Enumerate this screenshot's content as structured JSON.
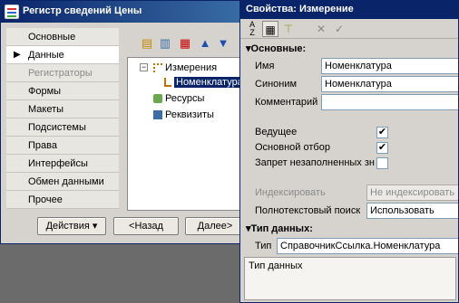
{
  "register_window": {
    "title": "Регистр сведений Цены",
    "nav": [
      {
        "label": "Основные",
        "state": "normal"
      },
      {
        "label": "Данные",
        "state": "active"
      },
      {
        "label": "Регистраторы",
        "state": "disabled"
      },
      {
        "label": "Формы",
        "state": "normal"
      },
      {
        "label": "Макеты",
        "state": "normal"
      },
      {
        "label": "Подсистемы",
        "state": "normal"
      },
      {
        "label": "Права",
        "state": "normal"
      },
      {
        "label": "Интерфейсы",
        "state": "normal"
      },
      {
        "label": "Обмен данными",
        "state": "normal"
      },
      {
        "label": "Прочее",
        "state": "normal"
      }
    ],
    "tree": {
      "dimensions": "Измерения",
      "selected": "Номенклатура",
      "resources": "Ресурсы",
      "attributes": "Реквизиты",
      "expand_symbol": "−"
    },
    "buttons": {
      "actions": "Действия",
      "back": "<Назад",
      "next": "Далее>"
    },
    "active_marker": "▶",
    "dropdown_arrow": "▾"
  },
  "props_window": {
    "title": "Свойства: Измерение",
    "sections": {
      "main": "Основные:",
      "data_type": "Тип данных:",
      "collapse_symbol": "▾"
    },
    "fields": {
      "name_label": "Имя",
      "name_value": "Номенклатура",
      "synonym_label": "Синоним",
      "synonym_value": "Номенклатура",
      "comment_label": "Комментарий",
      "comment_value": "",
      "master_label": "Ведущее",
      "master_checked": true,
      "main_filter_label": "Основной отбор",
      "main_filter_checked": true,
      "deny_unfilled_label": "Запрет незаполненных зн",
      "deny_unfilled_checked": false,
      "index_label": "Индексировать",
      "index_value": "Не индексировать",
      "fulltext_label": "Полнотекстовый поиск",
      "fulltext_value": "Использовать",
      "type_label": "Тип",
      "type_value": "СправочникСсылка.Номенклатура"
    },
    "check_symbol": "✔",
    "description": "Тип данных"
  },
  "colors": {
    "titlebar": "#0a246a",
    "selection": "#0a246a",
    "window_bg": "#d6d3ce",
    "desktop": "#6b6b6b"
  }
}
